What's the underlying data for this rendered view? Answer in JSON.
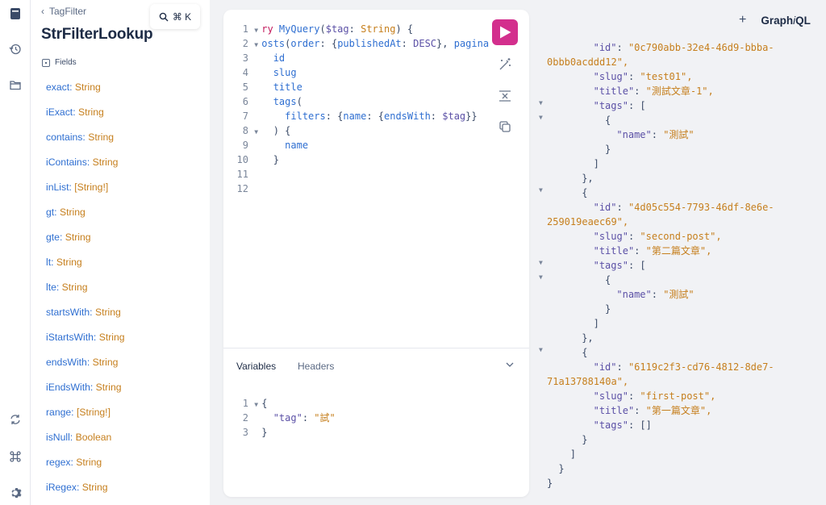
{
  "rail": {
    "icons": [
      "docs-icon",
      "history-icon",
      "folder-icon",
      "refetch-icon",
      "shortcut-icon",
      "settings-icon"
    ]
  },
  "docs": {
    "breadcrumb": "TagFilter",
    "title": "StrFilterLookup",
    "fields_label": "Fields",
    "fields": [
      {
        "name": "exact",
        "type": "String"
      },
      {
        "name": "iExact",
        "type": "String"
      },
      {
        "name": "contains",
        "type": "String"
      },
      {
        "name": "iContains",
        "type": "String"
      },
      {
        "name": "inList",
        "type": "[String!]"
      },
      {
        "name": "gt",
        "type": "String"
      },
      {
        "name": "gte",
        "type": "String"
      },
      {
        "name": "lt",
        "type": "String"
      },
      {
        "name": "lte",
        "type": "String"
      },
      {
        "name": "startsWith",
        "type": "String"
      },
      {
        "name": "iStartsWith",
        "type": "String"
      },
      {
        "name": "endsWith",
        "type": "String"
      },
      {
        "name": "iEndsWith",
        "type": "String"
      },
      {
        "name": "range",
        "type": "[String!]"
      },
      {
        "name": "isNull",
        "type": "Boolean"
      },
      {
        "name": "regex",
        "type": "String"
      },
      {
        "name": "iRegex",
        "type": "String"
      }
    ]
  },
  "search": {
    "shortcut": "⌘ K"
  },
  "editor": {
    "line_numbers": [
      "1",
      "2",
      "3",
      "4",
      "5",
      "6",
      "7",
      "8",
      "9",
      "10",
      "11",
      "12"
    ],
    "lines": [
      "ry MyQuery($tag: String) {",
      "osts(order: {publishedAt: DESC}, pagina",
      "id",
      "slug",
      "title",
      "tags(",
      "filters: {name: {endsWith: $tag}}",
      ") {",
      "name",
      "}",
      "",
      ""
    ]
  },
  "variables": {
    "tab_variables": "Variables",
    "tab_headers": "Headers",
    "line_numbers": [
      "1",
      "2",
      "3"
    ],
    "key": "\"tag\"",
    "value": "\"試\""
  },
  "result_header": {
    "plus": "+",
    "brand_prefix": "Graph",
    "brand_i": "i",
    "brand_suffix": "QL"
  },
  "result": {
    "posts": [
      {
        "id_line1": "\"0c790abb-32e4-46d9-bbba-",
        "id_line2": "0bbb0acddd12\",",
        "slug": "\"test01\",",
        "title": "\"測試文章-1\",",
        "tag": "\"測試\""
      },
      {
        "id_line1": "\"4d05c554-7793-46df-8e6e-",
        "id_line2": "259019eaec69\",",
        "slug": "\"second-post\",",
        "title": "\"第二篇文章\",",
        "tag": "\"測試\""
      },
      {
        "id_line1": "\"6119c2f3-cd76-4812-8de7-",
        "id_line2": "71a13788140a\",",
        "slug": "\"first-post\",",
        "title": "\"第一篇文章\",",
        "tags_empty": "[]"
      }
    ],
    "keys": {
      "id": "\"id\"",
      "slug": "\"slug\"",
      "title": "\"title\"",
      "tags": "\"tags\"",
      "name": "\"name\""
    }
  }
}
